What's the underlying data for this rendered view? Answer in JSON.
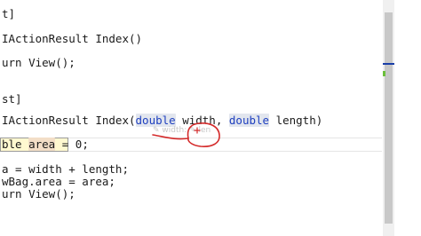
{
  "editor": {
    "lines": [
      {
        "id": "l1",
        "text": "t]"
      },
      {
        "id": "l2",
        "text": "IActionResult Index()"
      },
      {
        "id": "l3",
        "text": "urn View();"
      },
      {
        "id": "l4",
        "text": "st]"
      },
      {
        "id": "l5",
        "parts": {
          "pre": "IActionResult Index(",
          "kw1": "double",
          "p1": " width, ",
          "kw2": "double",
          "p2": " length)"
        }
      },
      {
        "id": "l6",
        "parts": {
          "pre": "ble ",
          "var": "area",
          "post": " = 0;"
        }
      },
      {
        "id": "l7",
        "text": "a = width + length;"
      },
      {
        "id": "l8",
        "text": "wBag.area = area;"
      },
      {
        "id": "l9",
        "text": "urn View();"
      }
    ],
    "param_hint": "✎ width: ✎ len"
  },
  "colors": {
    "keyword": "#1e3fbf",
    "annotation": "#d42a2a",
    "scroll_marker": "#1a3fa8",
    "change_marker": "#6bbf3b"
  }
}
